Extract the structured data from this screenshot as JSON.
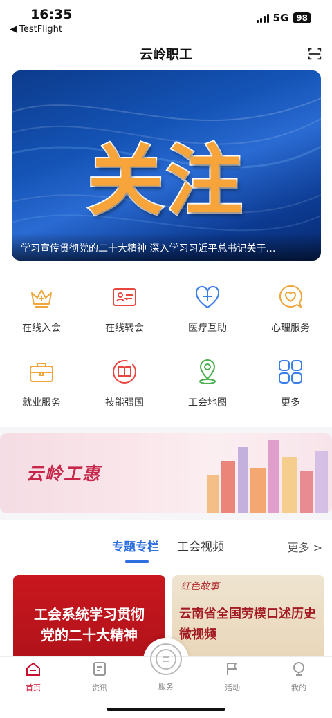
{
  "status_bar": {
    "time": "16:35",
    "back_app": "◀ TestFlight",
    "network": "5G",
    "battery": "98"
  },
  "header": {
    "title": "云岭职工",
    "scan_icon": "scan-icon"
  },
  "banner": {
    "big_text": "关注",
    "caption": "学习宣传贯彻党的二十大精神 深入学习习近平总书记关于…"
  },
  "services": [
    {
      "label": "在线入会",
      "icon": "crown-plus-icon",
      "color": "#f0a63a"
    },
    {
      "label": "在线转会",
      "icon": "id-card-transfer-icon",
      "color": "#e8463f"
    },
    {
      "label": "医疗互助",
      "icon": "heart-plus-icon",
      "color": "#3a7ee8"
    },
    {
      "label": "心理服务",
      "icon": "chat-heart-icon",
      "color": "#f0a63a"
    },
    {
      "label": "就业服务",
      "icon": "briefcase-icon",
      "color": "#f0a63a"
    },
    {
      "label": "技能强国",
      "icon": "book-icon",
      "color": "#e8463f"
    },
    {
      "label": "工会地图",
      "icon": "map-pin-icon",
      "color": "#4caf50"
    },
    {
      "label": "更多",
      "icon": "grid-icon",
      "color": "#3a7ee8"
    }
  ],
  "promo": {
    "text": "云岭工惠"
  },
  "tabs": {
    "active": "专题专栏",
    "other": "工会视频",
    "more": "更多 >"
  },
  "cards": [
    {
      "title_line1": "工会系统学习贯彻",
      "title_line2": "党的二十大精神"
    },
    {
      "script": "红色故事",
      "title_line1": "云南省全国劳模口述历史",
      "title_line2": "微视频"
    }
  ],
  "tabbar": [
    {
      "label": "首页",
      "icon": "home-icon",
      "active": true
    },
    {
      "label": "资讯",
      "icon": "news-icon",
      "active": false
    },
    {
      "label": "服务",
      "icon": "service-icon",
      "active": false
    },
    {
      "label": "活动",
      "icon": "flag-icon",
      "active": false
    },
    {
      "label": "我的",
      "icon": "profile-icon",
      "active": false
    }
  ],
  "colors": {
    "brand": "#c8102e",
    "accent_blue": "#2d6fe0"
  }
}
